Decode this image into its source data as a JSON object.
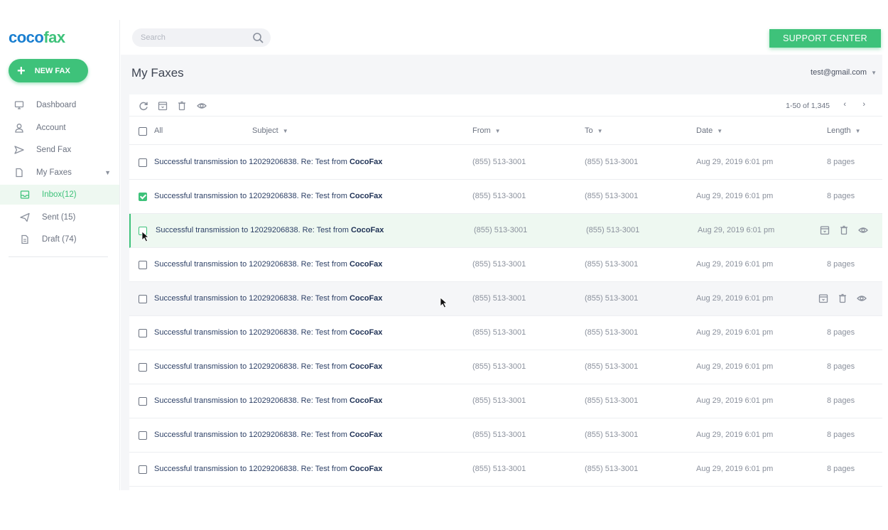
{
  "brand": {
    "part1": "coco",
    "part2": "fax"
  },
  "new_fax_label": "NEW FAX",
  "search": {
    "placeholder": "Search"
  },
  "support_label": "SUPPORT CENTER",
  "nav": {
    "dashboard": "Dashboard",
    "account": "Account",
    "send_fax": "Send Fax",
    "my_faxes": "My Faxes",
    "inbox": "Inbox(12)",
    "sent": "Sent (15)",
    "draft": "Draft (74)"
  },
  "page": {
    "title": "My Faxes",
    "user_email": "test@gmail.com"
  },
  "pagination": {
    "range": "1-50 of 1,345",
    "prev": "‹",
    "next": "›"
  },
  "columns": {
    "all": "All",
    "subject": "Subject",
    "from": "From",
    "to": "To",
    "date": "Date",
    "length": "Length"
  },
  "rows": [
    {
      "subject_prefix": "Successful transmission to 12029206838. Re: Test from ",
      "subject_brand": "CocoFax",
      "from": "(855) 513-3001",
      "to": "(855) 513-3001",
      "date": "Aug 29, 2019 6:01 pm",
      "length": "8 pages",
      "checked": false,
      "state": "normal"
    },
    {
      "subject_prefix": "Successful transmission to 12029206838. Re: Test from ",
      "subject_brand": "CocoFax",
      "from": "(855) 513-3001",
      "to": "(855) 513-3001",
      "date": "Aug 29, 2019 6:01 pm",
      "length": "8 pages",
      "checked": true,
      "state": "normal"
    },
    {
      "subject_prefix": "Successful transmission to 12029206838. Re: Test from ",
      "subject_brand": "CocoFax",
      "from": "(855) 513-3001",
      "to": "(855) 513-3001",
      "date": "Aug 29, 2019 6:01 pm",
      "length": "",
      "checked": false,
      "state": "selected"
    },
    {
      "subject_prefix": "Successful transmission to 12029206838. Re: Test from ",
      "subject_brand": "CocoFax",
      "from": "(855) 513-3001",
      "to": "(855) 513-3001",
      "date": "Aug 29, 2019 6:01 pm",
      "length": "8 pages",
      "checked": false,
      "state": "normal"
    },
    {
      "subject_prefix": "Successful transmission to 12029206838. Re: Test from ",
      "subject_brand": "CocoFax",
      "from": "(855) 513-3001",
      "to": "(855) 513-3001",
      "date": "Aug 29, 2019 6:01 pm",
      "length": "",
      "checked": false,
      "state": "hover"
    },
    {
      "subject_prefix": "Successful transmission to 12029206838. Re: Test from ",
      "subject_brand": "CocoFax",
      "from": "(855) 513-3001",
      "to": "(855) 513-3001",
      "date": "Aug 29, 2019 6:01 pm",
      "length": "8 pages",
      "checked": false,
      "state": "normal"
    },
    {
      "subject_prefix": "Successful transmission to 12029206838. Re: Test from ",
      "subject_brand": "CocoFax",
      "from": "(855) 513-3001",
      "to": "(855) 513-3001",
      "date": "Aug 29, 2019 6:01 pm",
      "length": "8 pages",
      "checked": false,
      "state": "normal"
    },
    {
      "subject_prefix": "Successful transmission to 12029206838. Re: Test from ",
      "subject_brand": "CocoFax",
      "from": "(855) 513-3001",
      "to": "(855) 513-3001",
      "date": "Aug 29, 2019 6:01 pm",
      "length": "8 pages",
      "checked": false,
      "state": "normal"
    },
    {
      "subject_prefix": "Successful transmission to 12029206838. Re: Test from ",
      "subject_brand": "CocoFax",
      "from": "(855) 513-3001",
      "to": "(855) 513-3001",
      "date": "Aug 29, 2019 6:01 pm",
      "length": "8 pages",
      "checked": false,
      "state": "normal"
    },
    {
      "subject_prefix": "Successful transmission to 12029206838. Re: Test from ",
      "subject_brand": "CocoFax",
      "from": "(855) 513-3001",
      "to": "(855) 513-3001",
      "date": "Aug 29, 2019 6:01 pm",
      "length": "8 pages",
      "checked": false,
      "state": "normal"
    }
  ],
  "colors": {
    "accent": "#3ec27a",
    "brand_blue": "#1a7fd0"
  }
}
